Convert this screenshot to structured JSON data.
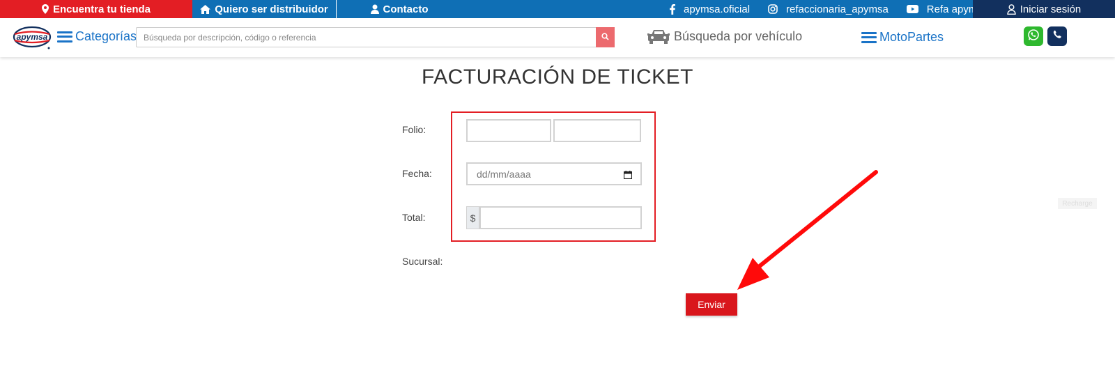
{
  "topbar": {
    "store_label": "Encuentra tu tienda",
    "distributor_label": "Quiero ser distribuidor",
    "contact_label": "Contacto",
    "facebook_label": "apymsa.oficial",
    "instagram_label": "refaccionaria_apymsa",
    "youtube_label": "Refa apymsa",
    "login_label": "Iniciar sesión"
  },
  "header": {
    "logo_text": "apymsa",
    "categories_label": "Categorías",
    "search_placeholder": "Búsqueda por descripción, código o referencia",
    "vehicle_search_label": "Búsqueda por vehículo",
    "motoparts_label": "MotoPartes"
  },
  "main": {
    "title": "FACTURACIÓN DE TICKET",
    "folio_label": "Folio:",
    "fecha_label": "Fecha:",
    "fecha_placeholder": "dd/mm/aaaa",
    "total_label": "Total:",
    "currency_symbol": "$",
    "sucursal_label": "Sucursal:",
    "send_label": "Enviar",
    "faded_badge": "Recharge"
  },
  "colors": {
    "primary_blue": "#0f6fb5",
    "accent_red": "#e31e24",
    "dark_navy": "#12305e",
    "whatsapp_green": "#2eb82e"
  },
  "icons": [
    "map-marker-icon",
    "home-icon",
    "user-icon",
    "facebook-icon",
    "instagram-icon",
    "youtube-icon",
    "user-outline-icon",
    "hamburger-icon",
    "search-icon",
    "car-icon",
    "whatsapp-icon",
    "phone-icon",
    "calendar-icon",
    "arrow-annotation"
  ]
}
